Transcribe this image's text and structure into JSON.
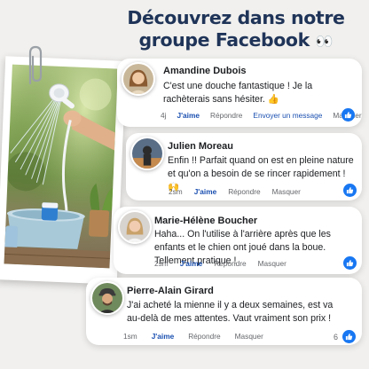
{
  "headline": {
    "line1": "Découvrez dans notre",
    "line2": "groupe Facebook",
    "emoji": "👀"
  },
  "photo": {
    "icons": [
      "paperclip-icon",
      "shower-head-icon"
    ]
  },
  "comments": [
    {
      "name": "Amandine Dubois",
      "text": "C'est une douche fantastique ! Je la rachèterais sans hésiter. 👍",
      "time": "4j",
      "like": "J'aime",
      "reply": "Répondre",
      "send": "Envoyer un message",
      "hide": "Masquer"
    },
    {
      "name": "Julien Moreau",
      "text": "Enfin !! Parfait quand on est en pleine nature et qu'on a besoin de se rincer rapidement ! 🙌",
      "time": "2sm",
      "like": "J'aime",
      "reply": "Répondre",
      "hide": "Masquer"
    },
    {
      "name": "Marie-Hélène Boucher",
      "text": "Haha... On l'utilise à l'arrière après que les enfants et le chien ont joué dans la boue. Tellement pratique !",
      "time": "2sm",
      "like": "J'aime",
      "reply": "Répondre",
      "hide": "Masquer"
    },
    {
      "name": "Pierre-Alain Girard",
      "text": "J'ai acheté la mienne il y a deux semaines, est va au-delà de mes attentes. Vaut vraiment son prix !",
      "time": "1sm",
      "like": "J'aime",
      "reply": "Répondre",
      "hide": "Masquer",
      "like_count": "6"
    }
  ],
  "colors": {
    "headline": "#1f3458",
    "facebook_blue": "#1877f2",
    "like_text": "#1a4fb0",
    "background": "#f1f0ee"
  }
}
